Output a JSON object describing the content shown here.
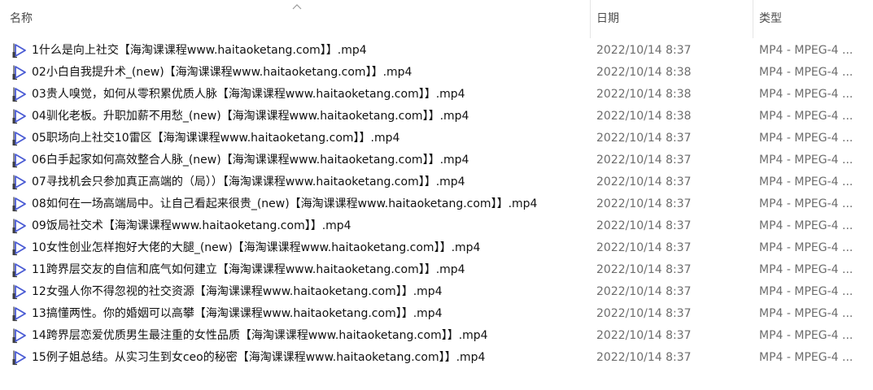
{
  "header": {
    "name_label": "名称",
    "date_label": "日期",
    "type_label": "类型",
    "sort_icon": "sort-ascending-icon"
  },
  "colors": {
    "icon_accent": "#4a5bd4",
    "date_text": "#6d6d6d"
  },
  "files": [
    {
      "name": "1什么是向上社交【海淘课课程www.haitaoketang.com】】.mp4",
      "date": "2022/10/14 8:37",
      "type": "MP4 - MPEG-4 ..."
    },
    {
      "name": "02小白自我提升术_(new)【海淘课课程www.haitaoketang.com】】.mp4",
      "date": "2022/10/14 8:38",
      "type": "MP4 - MPEG-4 ..."
    },
    {
      "name": "03贵人嗅觉，如何从零积累优质人脉【海淘课课程www.haitaoketang.com】】.mp4",
      "date": "2022/10/14 8:38",
      "type": "MP4 - MPEG-4 ..."
    },
    {
      "name": "04驯化老板。升职加薪不用愁_(new)【海淘课课程www.haitaoketang.com】】.mp4",
      "date": "2022/10/14 8:38",
      "type": "MP4 - MPEG-4 ..."
    },
    {
      "name": "05职场向上社交10雷区【海淘课课程www.haitaoketang.com】】.mp4",
      "date": "2022/10/14 8:37",
      "type": "MP4 - MPEG-4 ..."
    },
    {
      "name": "06白手起家如何高效整合人脉_(new)【海淘课课程www.haitaoketang.com】】.mp4",
      "date": "2022/10/14 8:37",
      "type": "MP4 - MPEG-4 ..."
    },
    {
      "name": "07寻找机会只参加真正高端的（局））【海淘课课程www.haitaoketang.com】】.mp4",
      "date": "2022/10/14 8:37",
      "type": "MP4 - MPEG-4 ..."
    },
    {
      "name": "08如何在一场高端局中。让自己看起来很贵_(new)【海淘课课程www.haitaoketang.com】】.mp4",
      "date": "2022/10/14 8:37",
      "type": "MP4 - MPEG-4 ..."
    },
    {
      "name": "09饭局社交术【海淘课课程www.haitaoketang.com】】.mp4",
      "date": "2022/10/14 8:37",
      "type": "MP4 - MPEG-4 ..."
    },
    {
      "name": "10女性创业怎样抱好大佬的大腿_(new)【海淘课课程www.haitaoketang.com】】.mp4",
      "date": "2022/10/14 8:37",
      "type": "MP4 - MPEG-4 ..."
    },
    {
      "name": "11跨界层交友的自信和底气如何建立【海淘课课程www.haitaoketang.com】】.mp4",
      "date": "2022/10/14 8:37",
      "type": "MP4 - MPEG-4 ..."
    },
    {
      "name": "12女强人你不得忽视的社交资源【海淘课课程www.haitaoketang.com】】.mp4",
      "date": "2022/10/14 8:37",
      "type": "MP4 - MPEG-4 ..."
    },
    {
      "name": "13搞懂两性。你的婚姻可以高攀【海淘课课程www.haitaoketang.com】】.mp4",
      "date": "2022/10/14 8:37",
      "type": "MP4 - MPEG-4 ..."
    },
    {
      "name": "14跨界层恋爱优质男生最注重的女性品质【海淘课课程www.haitaoketang.com】】.mp4",
      "date": "2022/10/14 8:37",
      "type": "MP4 - MPEG-4 ..."
    },
    {
      "name": "15例子姐总结。从实习生到女ceo的秘密【海淘课课程www.haitaoketang.com】】.mp4",
      "date": "2022/10/14 8:37",
      "type": "MP4 - MPEG-4 ..."
    }
  ]
}
